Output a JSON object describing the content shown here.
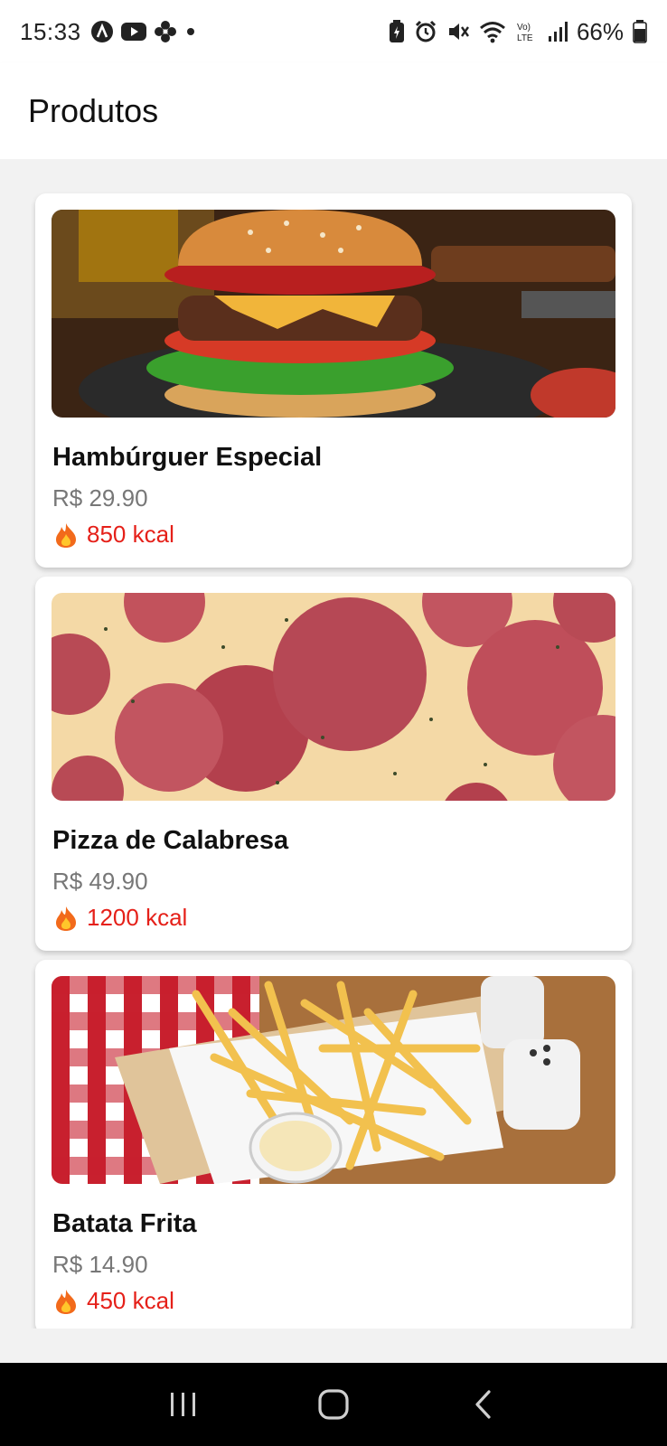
{
  "status_bar": {
    "time": "15:33",
    "battery": "66%",
    "left_icons": [
      "a-circle-icon",
      "youtube-icon",
      "pinwheel-icon",
      "dot-icon"
    ],
    "right_icons": [
      "battery-saver-icon",
      "alarm-icon",
      "mute-icon",
      "wifi-icon",
      "volte-icon",
      "signal-icon",
      "battery-icon"
    ],
    "volte_label": "Vo)\nLTE"
  },
  "header": {
    "title": "Produtos"
  },
  "products": [
    {
      "name": "Hambúrguer Especial",
      "price": "R$ 29.90",
      "kcal": "850 kcal",
      "image": "burger-image"
    },
    {
      "name": "Pizza de Calabresa",
      "price": "R$ 49.90",
      "kcal": "1200 kcal",
      "image": "pizza-image"
    },
    {
      "name": "Batata Frita",
      "price": "R$ 14.90",
      "kcal": "450 kcal",
      "image": "fries-image"
    }
  ],
  "nav_bar": {
    "buttons": [
      "recents-icon",
      "home-icon",
      "back-icon"
    ]
  },
  "colors": {
    "kcal": "#e52019",
    "price": "#777777",
    "background": "#f2f2f2"
  }
}
